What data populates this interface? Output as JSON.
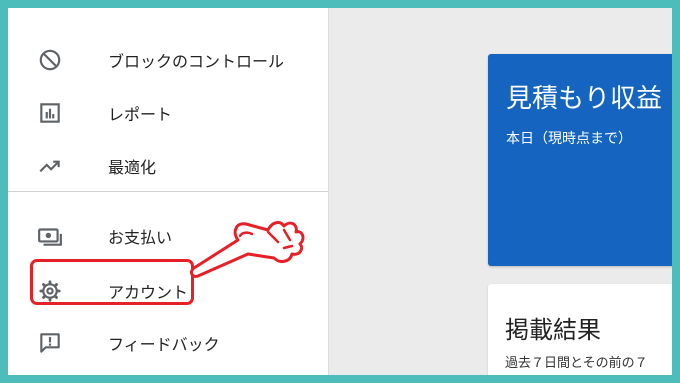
{
  "sidebar": {
    "items": [
      {
        "label": "ブロックのコントロール",
        "icon": "block-icon"
      },
      {
        "label": "レポート",
        "icon": "report-icon"
      },
      {
        "label": "最適化",
        "icon": "trending-up-icon"
      },
      {
        "label": "お支払い",
        "icon": "payments-icon"
      },
      {
        "label": "アカウント",
        "icon": "settings-gear-icon"
      },
      {
        "label": "フィードバック",
        "icon": "feedback-icon"
      }
    ]
  },
  "main": {
    "estimate_card": {
      "title": "見積もり収益",
      "subtitle": "本日（現時点まで）"
    },
    "performance_card": {
      "title": "掲載結果",
      "subtitle": "過去７日間とその前の７"
    }
  },
  "annotation": {
    "highlight_color": "#e52026",
    "frame_color": "#4cbdbb"
  },
  "colors": {
    "card_blue": "#1565c0",
    "icon_gray": "#5f6368"
  }
}
